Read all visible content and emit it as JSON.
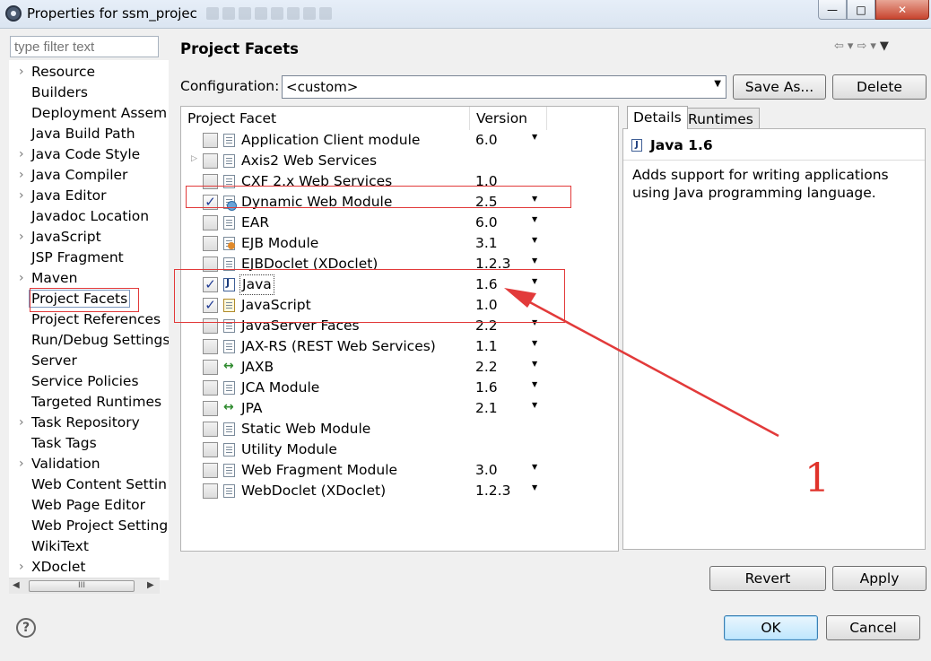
{
  "window": {
    "title": "Properties for ssm_projec"
  },
  "filter": {
    "placeholder": "type filter text"
  },
  "nav": {
    "items": [
      {
        "label": "Resource",
        "expandable": true
      },
      {
        "label": "Builders",
        "expandable": false
      },
      {
        "label": "Deployment Assem",
        "expandable": false
      },
      {
        "label": "Java Build Path",
        "expandable": false
      },
      {
        "label": "Java Code Style",
        "expandable": true
      },
      {
        "label": "Java Compiler",
        "expandable": true
      },
      {
        "label": "Java Editor",
        "expandable": true
      },
      {
        "label": "Javadoc Location",
        "expandable": false
      },
      {
        "label": "JavaScript",
        "expandable": true
      },
      {
        "label": "JSP Fragment",
        "expandable": false
      },
      {
        "label": "Maven",
        "expandable": true
      },
      {
        "label": "Project Facets",
        "expandable": false,
        "selected": true
      },
      {
        "label": "Project References",
        "expandable": false
      },
      {
        "label": "Run/Debug Settings",
        "expandable": false
      },
      {
        "label": "Server",
        "expandable": false
      },
      {
        "label": "Service Policies",
        "expandable": false
      },
      {
        "label": "Targeted Runtimes",
        "expandable": false
      },
      {
        "label": "Task Repository",
        "expandable": true
      },
      {
        "label": "Task Tags",
        "expandable": false
      },
      {
        "label": "Validation",
        "expandable": true
      },
      {
        "label": "Web Content Settin",
        "expandable": false
      },
      {
        "label": "Web Page Editor",
        "expandable": false
      },
      {
        "label": "Web Project Setting",
        "expandable": false
      },
      {
        "label": "WikiText",
        "expandable": false
      },
      {
        "label": "XDoclet",
        "expandable": true
      }
    ],
    "scroll_thumb_label": "III"
  },
  "page": {
    "title": "Project Facets"
  },
  "configuration": {
    "label": "Configuration:",
    "value": "<custom>",
    "save_as_label": "Save As...",
    "delete_label": "Delete"
  },
  "facets": {
    "columns": [
      "Project Facet",
      "Version"
    ],
    "rows": [
      {
        "name": "Application Client module",
        "version": "6.0",
        "checked": false,
        "icon": "document-icon",
        "dropdown": true,
        "expandable": false
      },
      {
        "name": "Axis2 Web Services",
        "version": "",
        "checked": false,
        "icon": "document-icon",
        "dropdown": false,
        "expandable": true
      },
      {
        "name": "CXF 2.x Web Services",
        "version": "1.0",
        "checked": false,
        "icon": "document-icon",
        "dropdown": false,
        "expandable": false
      },
      {
        "name": "Dynamic Web Module",
        "version": "2.5",
        "checked": true,
        "icon": "globe-icon",
        "dropdown": true,
        "expandable": false
      },
      {
        "name": "EAR",
        "version": "6.0",
        "checked": false,
        "icon": "document-icon",
        "dropdown": true,
        "expandable": false
      },
      {
        "name": "EJB Module",
        "version": "3.1",
        "checked": false,
        "icon": "bean-icon",
        "dropdown": true,
        "expandable": false
      },
      {
        "name": "EJBDoclet (XDoclet)",
        "version": "1.2.3",
        "checked": false,
        "icon": "document-icon",
        "dropdown": true,
        "expandable": false
      },
      {
        "name": "Java",
        "version": "1.6",
        "checked": true,
        "icon": "java-icon",
        "dropdown": true,
        "expandable": false,
        "selected": true
      },
      {
        "name": "JavaScript",
        "version": "1.0",
        "checked": true,
        "icon": "javascript-icon",
        "dropdown": false,
        "expandable": false
      },
      {
        "name": "JavaServer Faces",
        "version": "2.2",
        "checked": false,
        "icon": "document-icon",
        "dropdown": true,
        "expandable": false
      },
      {
        "name": "JAX-RS (REST Web Services)",
        "version": "1.1",
        "checked": false,
        "icon": "document-icon",
        "dropdown": true,
        "expandable": false
      },
      {
        "name": "JAXB",
        "version": "2.2",
        "checked": false,
        "icon": "connector-icon",
        "dropdown": true,
        "expandable": false
      },
      {
        "name": "JCA Module",
        "version": "1.6",
        "checked": false,
        "icon": "document-icon",
        "dropdown": true,
        "expandable": false
      },
      {
        "name": "JPA",
        "version": "2.1",
        "checked": false,
        "icon": "connector-icon",
        "dropdown": true,
        "expandable": false
      },
      {
        "name": "Static Web Module",
        "version": "",
        "checked": false,
        "icon": "document-icon",
        "dropdown": false,
        "expandable": false
      },
      {
        "name": "Utility Module",
        "version": "",
        "checked": false,
        "icon": "document-icon",
        "dropdown": false,
        "expandable": false
      },
      {
        "name": "Web Fragment Module",
        "version": "3.0",
        "checked": false,
        "icon": "document-icon",
        "dropdown": true,
        "expandable": false
      },
      {
        "name": "WebDoclet (XDoclet)",
        "version": "1.2.3",
        "checked": false,
        "icon": "document-icon",
        "dropdown": true,
        "expandable": false
      }
    ]
  },
  "details": {
    "tabs": [
      "Details",
      "Runtimes"
    ],
    "active_tab": "Details",
    "heading": "Java 1.6",
    "description": "Adds support for writing applications using Java programming language."
  },
  "buttons": {
    "revert": "Revert",
    "apply": "Apply",
    "ok": "OK",
    "cancel": "Cancel",
    "help": "?"
  },
  "annotation": {
    "label": "1",
    "color": "#e23a3a"
  }
}
